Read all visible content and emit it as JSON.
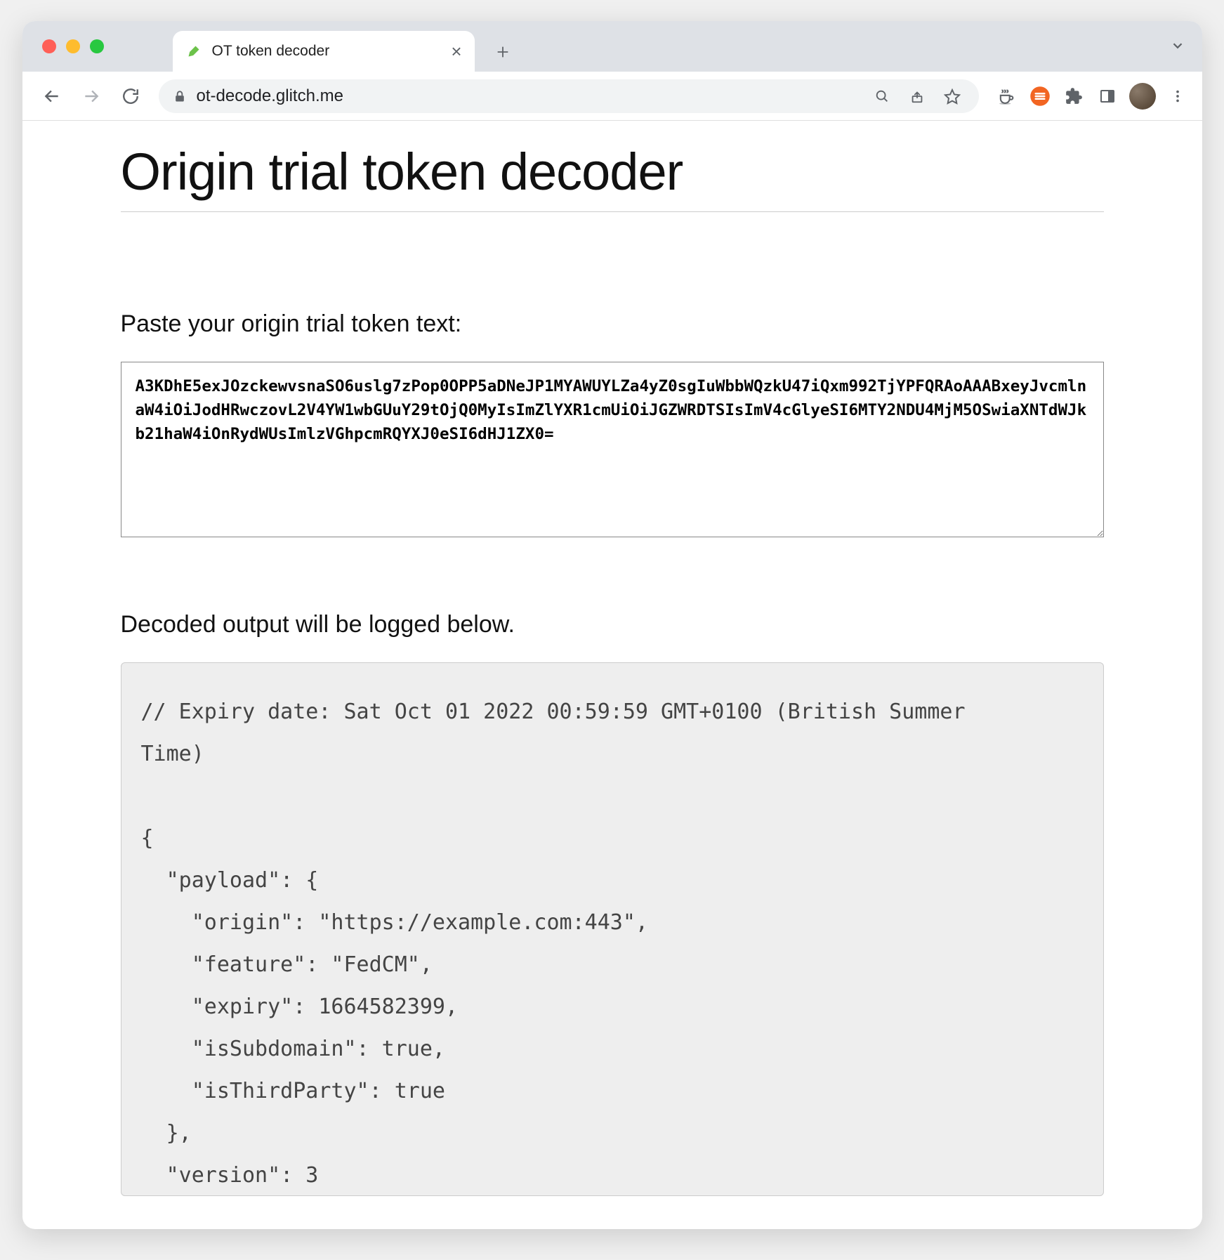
{
  "browser": {
    "tab_title": "OT token decoder",
    "url": "ot-decode.glitch.me"
  },
  "page": {
    "title": "Origin trial token decoder",
    "paste_label": "Paste your origin trial token text:",
    "token_value": "A3KDhE5exJOzckewvsnaSO6uslg7zPop0OPP5aDNeJP1MYAWUYLZa4yZ0sgIuWbbWQzkU47iQxm992TjYPFQRAoAAABxeyJvcmlnaW4iOiJodHRwczovL2V4YW1wbGUuY29tOjQ0MyIsImZlYXR1cmUiOiJGZWRDTSIsImV4cGlyeSI6MTY2NDU4MjM5OSwiaXNTdWJkb21haW4iOnRydWUsImlzVGhpcmRQYXJ0eSI6dHJ1ZX0=",
    "output_label": "Decoded output will be logged below.",
    "output_text": "// Expiry date: Sat Oct 01 2022 00:59:59 GMT+0100 (British Summer\nTime)\n\n{\n  \"payload\": {\n    \"origin\": \"https://example.com:443\",\n    \"feature\": \"FedCM\",\n    \"expiry\": 1664582399,\n    \"isSubdomain\": true,\n    \"isThirdParty\": true\n  },\n  \"version\": 3"
  }
}
